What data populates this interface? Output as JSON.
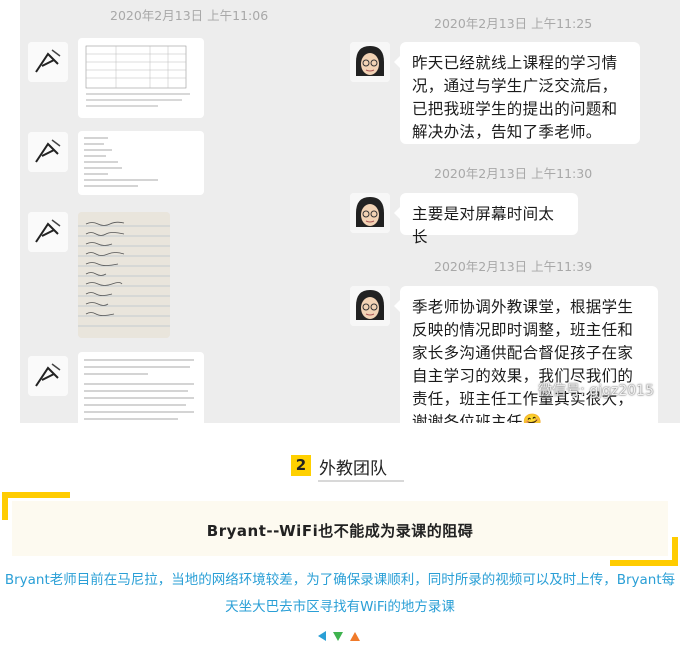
{
  "chat": {
    "timestamps": [
      "2020年2月13日 上午11:06",
      "2020年2月13日 上午11:25",
      "2020年2月13日 上午11:30",
      "2020年2月13日 上午11:39"
    ],
    "messages": [
      {
        "text": "昨天已经就线上课程的学习情况，通过与学生广泛交流后，已把我班学生的提出的问题和解决办法，告知了季老师。"
      },
      {
        "text": "主要是对屏幕时间太长"
      },
      {
        "text": "季老师协调外教课堂，根据学生反映的情况即时调整，班主任和家长多沟通供配合督促孩子在家自主学习的效果，我们尽我们的责任，班主任工作量其实很大，谢谢各位班主任🤗"
      }
    ],
    "watermark": "微信号: gjgz2015",
    "attachments": [
      {
        "type": "document-table"
      },
      {
        "type": "text-list"
      },
      {
        "type": "lined-paper-photo"
      },
      {
        "type": "text-note"
      }
    ]
  },
  "section": {
    "number": "2",
    "title": "外教团队"
  },
  "banner": {
    "text": "Bryant--WiFi也不能成为录课的阻碍"
  },
  "description": {
    "line1": "Bryant老师目前在马尼拉，当地的网络环境较差，为了确保录课顺利，同时所录的视频可以及时上传，Bryant每",
    "line2": "天坐大巴去市区寻找有WiFi的地方录课"
  },
  "colors": {
    "accent": "#ffcc00",
    "link_text": "#2a9fd6",
    "arrow_left": "#2a9fd6",
    "arrow_down": "#3fb34f",
    "arrow_up": "#f07a2a"
  }
}
